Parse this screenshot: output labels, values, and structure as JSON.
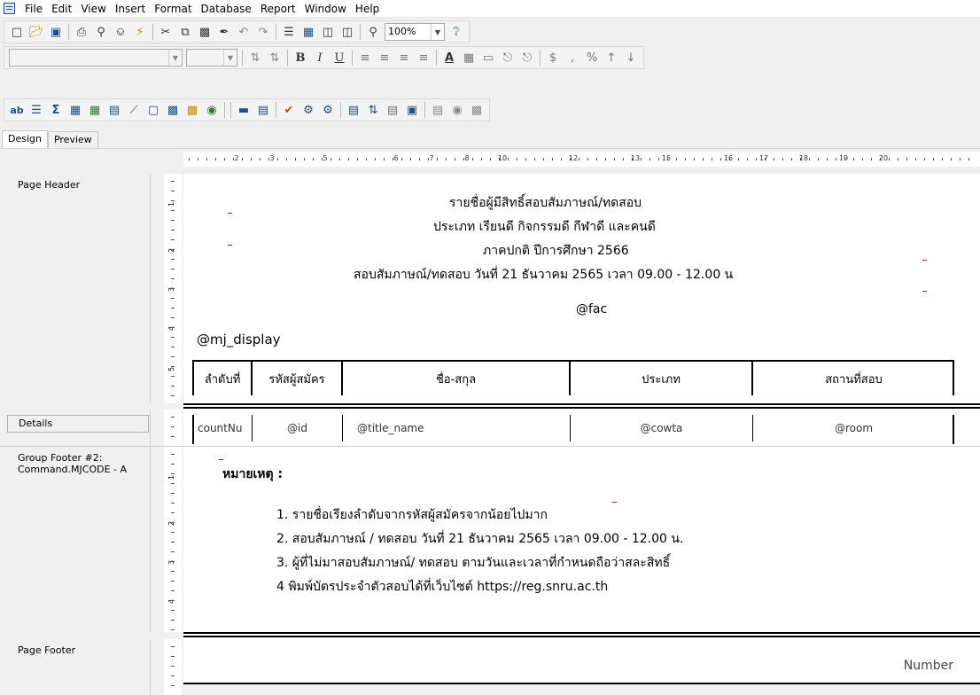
{
  "menubar": [
    "File",
    "Edit",
    "View",
    "Insert",
    "Format",
    "Database",
    "Report",
    "Window",
    "Help"
  ],
  "toolbar": {
    "zoom": "100%"
  },
  "format_toolbar": {
    "font_name": "",
    "font_size": ""
  },
  "tabs": [
    "Design",
    "Preview"
  ],
  "ruler": [
    "2",
    "3",
    "5",
    "6",
    "7",
    "8",
    "10",
    "12",
    "13",
    "15",
    "16",
    "17",
    "18",
    "19",
    "20"
  ],
  "vruler": {
    "header": [
      "1",
      "2",
      "3",
      "4",
      "5"
    ],
    "footer": [
      "1",
      "2",
      "3",
      "4"
    ]
  },
  "sections": {
    "page_header": "Page Header",
    "details": "Details",
    "group_footer": "Group Footer #2:\nCommand.MJCODE - A",
    "page_footer": "Page Footer"
  },
  "header_fields": {
    "title1": "รายชื่อผู้มีสิทธิ์สอบสัมภาษณ์/ทดสอบ",
    "title2": "ประเภท  เรียนดี กิจกรรมดี กีฬาดี และคนดี",
    "title3": "ภาคปกติ  ปีการศึกษา 2566",
    "title4": "สอบสัมภาษณ์/ทดสอบ วันที่ 21 ธันวาคม 2565 เวลา 09.00 - 12.00 น",
    "fac": "@fac",
    "mj_display": "@mj_display"
  },
  "columns": [
    "ลำดับที่",
    "รหัสผู้สมัคร",
    "ชื่อ-สกุล",
    "ประเภท",
    "สถานที่สอบ"
  ],
  "detail_fields": [
    "countNu",
    "@id",
    "@title_name",
    "@cowta",
    "@room"
  ],
  "footer_fields": {
    "remark": "หมายเหตุ :",
    "note1": "1. รายชื่อเรียงลำดับจากรหัสผู้สมัครจากน้อยไปมาก",
    "note2": "2. สอบสัมภาษณ์ / ทดสอบ วันที่ 21 ธันวาคม 2565 เวลา 09.00 - 12.00 น.",
    "note3": "3. ผู้ที่ไม่มาสอบสัมภาษณ์/ ทดสอบ ตามวันและเวลาที่กำหนดถือว่าสละสิทธิ์",
    "note4": "4 พิมพ์บัตรประจำตัวสอบได้ที่เว็บไซต์ https://reg.snru.ac.th"
  },
  "page_footer_fields": {
    "number": "Number"
  }
}
